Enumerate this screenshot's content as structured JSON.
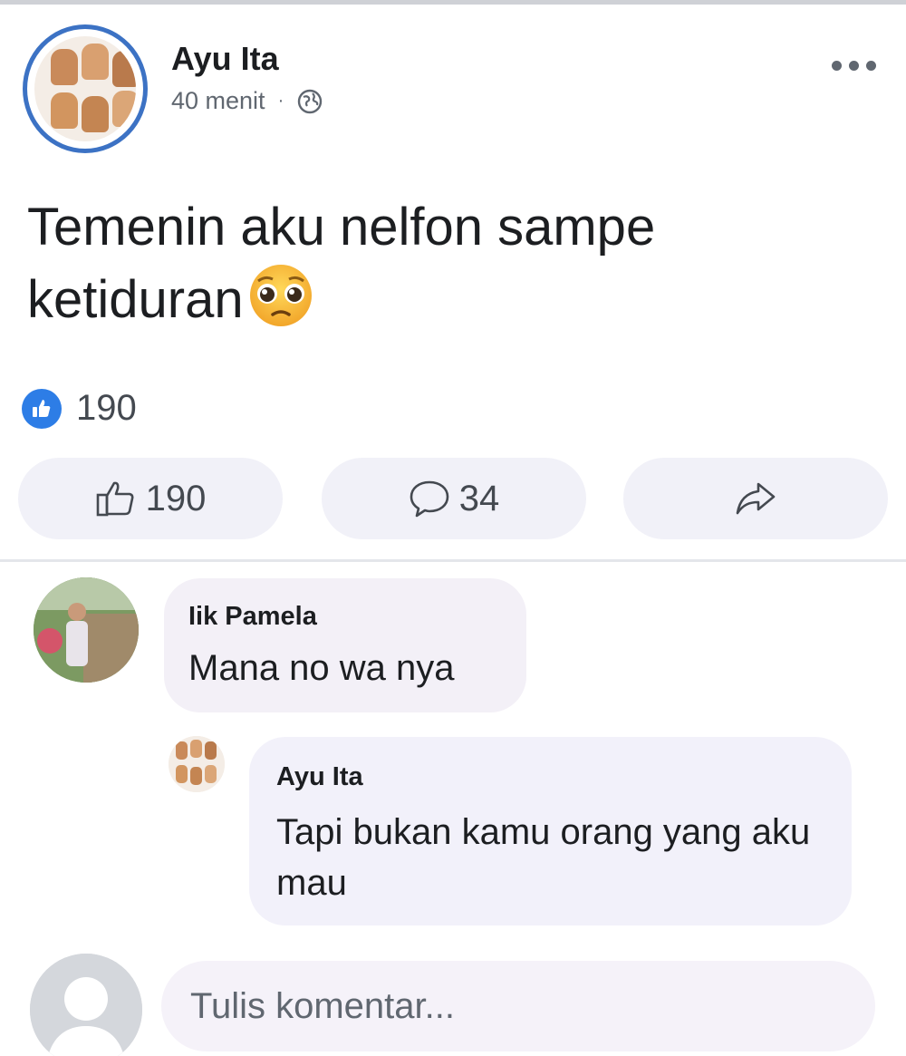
{
  "post": {
    "author": "Ayu Ita",
    "time": "40 menit",
    "separator": "·",
    "privacy_icon": "globe-icon",
    "text": "Temenin aku nelfon sampe ketiduran",
    "emoji": "pleading-face-emoji",
    "reaction_count": "190",
    "reaction_icon": "like-icon"
  },
  "actions": {
    "like_count": "190",
    "comment_count": "34",
    "share_icon": "share-icon"
  },
  "comments": [
    {
      "author": "Iik Pamela",
      "text": "Mana no wa nya"
    },
    {
      "author": "Ayu Ita",
      "text": "Tapi bukan kamu orang yang aku mau"
    }
  ],
  "composer": {
    "placeholder": "Tulis komentar..."
  },
  "colors": {
    "accent": "#2d7de6",
    "avatar_ring": "#3c72c4",
    "bubble": "#f3f0f7",
    "text": "#1c1e21",
    "muted": "#606770"
  }
}
